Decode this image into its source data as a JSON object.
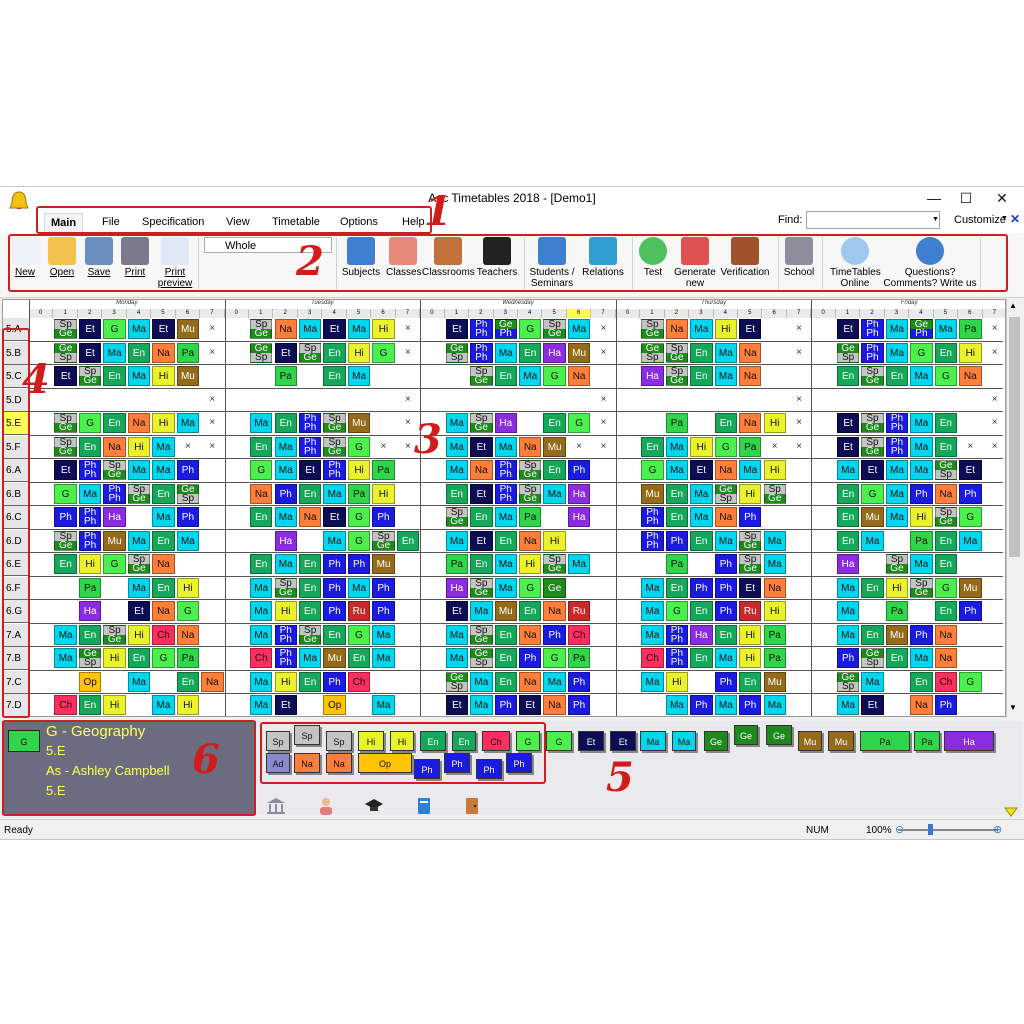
{
  "window": {
    "title": "Asc Timetables 2018  - [Demo1]"
  },
  "menu": {
    "tabs": [
      "Main",
      "File",
      "Specification",
      "View",
      "Timetable",
      "Options",
      "Help"
    ],
    "active": "Main"
  },
  "find": {
    "label": "Find:",
    "value": ""
  },
  "customize_label": "Customize",
  "ribbon": {
    "view_select": "Whole",
    "buttons": [
      {
        "label": "New",
        "icon": "new-document-icon",
        "underline": true
      },
      {
        "label": "Open",
        "icon": "folder-open-icon",
        "underline": true
      },
      {
        "label": "Save",
        "icon": "floppy-disk-icon",
        "underline": true
      },
      {
        "label": "Print",
        "icon": "printer-icon",
        "underline": true
      },
      {
        "label": "Print\npreview",
        "icon": "print-preview-icon",
        "underline": true
      },
      {
        "label": "Subjects",
        "icon": "book-icon"
      },
      {
        "label": "Classes",
        "icon": "students-icon"
      },
      {
        "label": "Classrooms",
        "icon": "door-icon"
      },
      {
        "label": "Teachers",
        "icon": "graduation-cap-icon"
      },
      {
        "label": "Students /\nSeminars",
        "icon": "student-check-icon"
      },
      {
        "label": "Relations",
        "icon": "network-icon"
      },
      {
        "label": "Test",
        "icon": "check-circle-icon"
      },
      {
        "label": "Generate\nnew",
        "icon": "beacon-icon"
      },
      {
        "label": "Verification",
        "icon": "gavel-icon"
      },
      {
        "label": "School",
        "icon": "building-icon"
      },
      {
        "label": "TimeTables\nOnline",
        "icon": "cloud-icon"
      },
      {
        "label": "Questions?\nComments? Write us",
        "icon": "help-icon"
      }
    ]
  },
  "grid": {
    "days": [
      "Monday",
      "Tuesday",
      "Wednesday",
      "Thursday",
      "Friday"
    ],
    "periods": [
      "0",
      "1",
      "2",
      "3",
      "4",
      "5",
      "6",
      "7"
    ],
    "highlight_period": {
      "day": 2,
      "period": 6
    },
    "classes": [
      "5.A",
      "5.B",
      "5.C",
      "5.D",
      "5.E",
      "5.F",
      "6.A",
      "6.B",
      "6.C",
      "6.D",
      "6.E",
      "6.F",
      "6.G",
      "7.A",
      "7.B",
      "7.C",
      "7.D"
    ],
    "highlight_class": "5.E",
    "rows": [
      "Sp/Ge,Et,G,Ma,Et,Mu,x|Sp/Ge,Na,Ma,Et,Ma,Hi,x|Et,Ph/Ph,Ge/Ph,G,Sp/Ge,Ma,x|Sp/Ge,Na,Ma,Hi,Et,,x|Et,Ph/Ph,Ma,Ge/Ph,Ma,Pa,x",
      "Ge/Sp,Et,Ma,En,Na,Pa,x|Ge/Sp,Et,Sp/Ge,En,Hi,G,x|Ge/Sp,Ph/Ph,Ma,En,Ha,Mu,x|Ge/Sp,Sp/Ge,En,Ma,Na,,x|Ge/Sp,Ph/Ph,Ma,G,En,Hi,x",
      "Et,Sp/Ge,En,Ma,Hi,Mu,|,Pa,,En,Ma,,|,Sp/Ge,En,Ma,G,Na,|Ha,Sp/Ge,En,Ma,Na,,|En,Sp/Ge,En,Ma,G,Na,",
      ",,,,,,x|,,,,,,x|,,,,,,x|,,,,,,x|,,,,,,x",
      "Sp/Ge,G,En,Na,Hi,Ma,x|Ma,En,Ph/Ph,Sp/Ge,Mu,,x|Ma,Sp/Ge,Ha,,En,G,x|,Pa,,En,Na,Hi,x|Et,Sp/Ge,Ph/Ph,Ma,En,,x",
      "Sp/Ge,En,Na,Hi,Ma,x,x|En,Ma,Ph/Ph,Sp/Ge,G,x,x|Ma,Et,Ma,Na,Mu,x,x|En,Ma,Hi,G,Pa,x,x|Et,Sp/Ge,Ph/Ph,Ma,En,x,x",
      "Et,Ph/Ph,Sp/Ge,Ma,Ma,Ph,|G,Ma,Et,Ph/Ph,Hi,Pa,|Ma,Na,Ph/Ph,Sp/Ge,En,Ph,|G,Ma,Et,Na,Ma,Hi,|Ma,Et,Ma,Ma,Ge/Sp,Et,",
      "G,Ma,Ph/Ph,Sp/Ge,En,Ge/Sp,|Na,Ph,En,Ma,Pa,Hi,|En,Et,Ph/Ph,Sp/Ge,Ma,Ha,|Mu,En,Ma,Ge/Sp,Hi,Sp/Ge,|En,G,Ma,Ph,Na,Ph,",
      "Ph,Ph/Ph,Ha,,Ma,Ph,|En,Ma,Na,Et,G,Ph,|Sp/Ge,En,Ma,Pa,,Ha,|Ph/Ph,En,Ma,Na,Ph,,|En,Mu,Ma,Hi,Sp/Ge,G,",
      "Sp/Ge,Ph/Ph,Mu,Ma,En,Ma,|,Ha,,Ma,G,Sp/Ge,En|Ma,Et,En,Na,Hi,,|Ph/Ph,Ph,En,Ma,Sp/Ge,Ma,|En,Ma,,Pa,En,Ma,",
      "En,Hi,G,Sp/Ge,Na,,|En,Ma,En,Ph,Ph,Mu,|Pa,En,Ma,Hi,Sp/Ge,Ma,|,Pa,,Ph,Sp/Ge,Ma,|Ha,,Sp/Ge,Ma,En,,",
      ",Pa,,Ma,En,Hi,|Ma,Sp/Ge,En,Ph,Ma,Ph,|Ha,Sp/Ge,Ma,G,Ge,,|Ma,En,Ph,Ph,Et,Na,|Ma,En,Hi,Sp/Ge,G,Mu,",
      ",Ha,,Et,Na,G,|Ma,Hi,En,Ph,Ru,Ph,|Et,Ma,Mu,En,Na,Ru,|Ma,G,En,Ph,Ru,Hi,|Ma,,Pa,,En,Ph,",
      "Ma,En,Sp/Ge,Hi,Ch,Na,|Ma,Ph/Ph,Sp/Ge,En,G,Ma,|Ma,Sp/Ge,En,Na,Ph,Ch,|Ma,Ph/Ph,Ha,En,Hi,Pa,|Ma,En,Mu,Ph,Na,,",
      "Ma,Ge/Sp,Hi,En,G,Pa,|Ch,Ph/Ph,Ma,Mu,En,Ma,|Ma,Ge/Sp,En,Ph,G,Pa,|Ch,Ph/Ph,En,Ma,Hi,Pa,|Ph,Ge/Sp,En,Ma,Na,,",
      ",Op,,Ma,,En,Na|Ma,Hi,En,Ph,Ch,,|Ge/Sp,Ma,En,Na,Ma,Ph,|Ma,Hi,,Ph,En,Mu,|Ge/Sp,Ma,,En,Ch,G,",
      "Ch,En,Hi,,Ma,Hi,|Ma,Et,,Op,,Ma,|Et,Ma,Ph,Et,Na,Ph,|,Ma,Ph,Ma,Ph,Ma,|Ma,Et,,Na,Ph,,"
    ]
  },
  "info": {
    "swatch": "G",
    "title": "G - Geography",
    "class1": "5.E",
    "teacher": "As - Ashley Campbell",
    "class2": "5.E"
  },
  "palette": {
    "row1": [
      "Sp",
      "Sp",
      "Sp",
      "Hi",
      "Hi",
      "En",
      "En",
      "Ch",
      "G",
      "G",
      "Et",
      "Et",
      "Ma",
      "Ma",
      "Ge",
      "Ge",
      "Ge",
      "Mu",
      "Mu",
      "Pa",
      "Pa",
      "Ha"
    ],
    "row2": [
      "Ad",
      "Na",
      "Na",
      "Op",
      "Ph",
      "Ph",
      "Ph",
      "Ph"
    ]
  },
  "status": {
    "ready": "Ready",
    "num": "NUM",
    "zoom": "100%"
  },
  "annotations": [
    "1",
    "2",
    "3",
    "4",
    "5",
    "6"
  ],
  "subject_colors": {
    "Sp": "#c4c4c4",
    "Ge": "#1e8a1e",
    "G": "#4cf04c",
    "Et": "#0d0d55",
    "Ma": "#00d7ee",
    "Mu": "#946b1a",
    "Na": "#ff7e3a",
    "Hi": "#e9f22a",
    "En": "#16a85a",
    "Pa": "#2fd64a",
    "Ph": "#1a1ae0",
    "Ha": "#8b2be2",
    "Ch": "#ff2e5f",
    "Op": "#ffc400",
    "Ru": "#c62a2a",
    "Ad": "#8a8ad0"
  }
}
